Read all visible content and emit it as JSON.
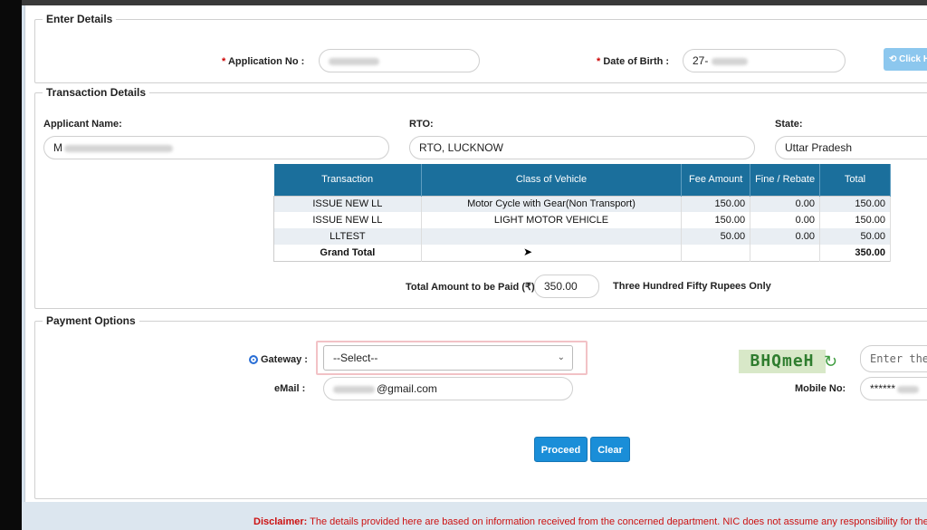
{
  "enter_details": {
    "legend": "Enter Details",
    "application_no_label": "Application No :",
    "dob_label": "Date of Birth :",
    "dob_value": "27-",
    "click_button_label": "Click H"
  },
  "transaction_details": {
    "legend": "Transaction Details",
    "applicant_label": "Applicant Name:",
    "applicant_value": "M",
    "rto_label": "RTO:",
    "rto_value": "RTO, LUCKNOW",
    "state_label": "State:",
    "state_value": "Uttar Pradesh",
    "table": {
      "headers": [
        "Transaction",
        "Class of Vehicle",
        "Fee Amount",
        "Fine / Rebate",
        "Total"
      ],
      "rows": [
        [
          "ISSUE NEW LL",
          "Motor Cycle with Gear(Non Transport)",
          "150.00",
          "0.00",
          "150.00"
        ],
        [
          "ISSUE NEW LL",
          "LIGHT MOTOR VEHICLE",
          "150.00",
          "0.00",
          "150.00"
        ],
        [
          "LLTEST",
          "",
          "50.00",
          "0.00",
          "50.00"
        ]
      ],
      "grand_total_label": "Grand Total",
      "grand_total_value": "350.00"
    },
    "total_label": "Total Amount to be Paid (₹):",
    "total_value": "350.00",
    "total_words": "Three Hundred Fifty Rupees Only"
  },
  "payment_options": {
    "legend": "Payment Options",
    "gateway_label": "Gateway :",
    "gateway_selected": "--Select--",
    "email_label": "eMail :",
    "email_value": "@gmail.com",
    "captcha_text": "BHQmeH",
    "captcha_placeholder": "Enter the c",
    "mobile_label": "Mobile No:",
    "mobile_value": "******",
    "proceed_label": "Proceed",
    "clear_label": "Clear"
  },
  "footer": {
    "disclaimer_label": "Disclaimer:",
    "disclaimer_text": " The details provided here are based on information received from the concerned department. NIC does not assume any responsibility for the content"
  },
  "colors": {
    "header_blue": "#1b6f9c",
    "button_blue": "#1a8ed8",
    "captcha_green": "#2f7d2f"
  }
}
